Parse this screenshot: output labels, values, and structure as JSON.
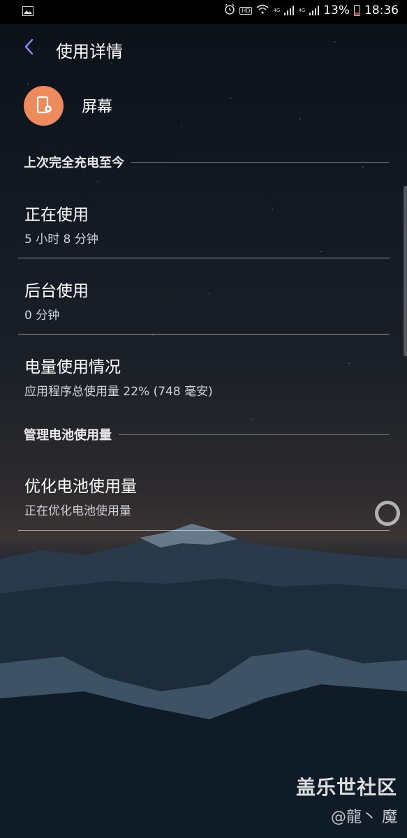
{
  "status_bar": {
    "battery_percent": "13%",
    "time": "18:36",
    "network_labels": [
      "4G",
      "4G"
    ],
    "hd_label": "HD",
    "icons": [
      "image-icon",
      "alarm-icon",
      "wifi-icon",
      "signal-icon",
      "battery-icon"
    ]
  },
  "header": {
    "title": "使用详情",
    "back_icon": "chevron-left-icon"
  },
  "app": {
    "name": "屏幕",
    "icon": "screen-settings-icon",
    "icon_color": "#ee8b5d"
  },
  "sections": {
    "since_full_charge": "上次完全充电至今",
    "manage_battery": "管理电池使用量"
  },
  "items": [
    {
      "title": "正在使用",
      "subtitle": "5 小时 8 分钟"
    },
    {
      "title": "后台使用",
      "subtitle": "0 分钟"
    },
    {
      "title": "电量使用情况",
      "subtitle": "应用程序总使用量 22% (748 毫安)"
    },
    {
      "title": "优化电池使用量",
      "subtitle": "正在优化电池使用量"
    }
  ],
  "watermark": {
    "line1": "盖乐世社区",
    "line2": "@龍丶 魔"
  },
  "colors": {
    "accent": "#8b93ff",
    "battery_low": "#e23c3c"
  }
}
